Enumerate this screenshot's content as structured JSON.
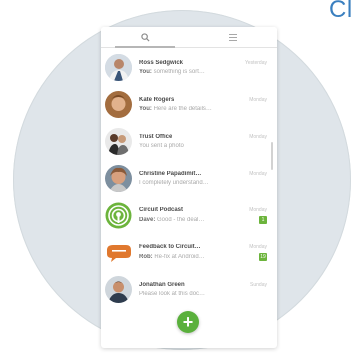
{
  "heading_fragment": "Cl",
  "tabs": [
    {
      "icon": "search-icon",
      "active": true
    },
    {
      "icon": "menu-icon",
      "active": false
    }
  ],
  "conversations": [
    {
      "name": "Ross Sedgwick",
      "time": "Yesterday",
      "sender": "You:",
      "preview": "something is sort…",
      "avatar": "person-photo",
      "unread": ""
    },
    {
      "name": "Kate Rogers",
      "time": "Monday",
      "sender": "You:",
      "preview": "Here are the details…",
      "avatar": "person-photo",
      "unread": ""
    },
    {
      "name": "Trust Office",
      "time": "Monday",
      "sender": "",
      "preview": "You sent a photo",
      "avatar": "person-photo",
      "unread": ""
    },
    {
      "name": "Christine Papadimit…",
      "time": "Monday",
      "sender": "",
      "preview": "I completely understand…",
      "avatar": "person-photo",
      "unread": ""
    },
    {
      "name": "Circuit Podcast",
      "time": "Monday",
      "sender": "Dave:",
      "preview": "Good - the deal…",
      "avatar": "podcast-icon",
      "unread": "1"
    },
    {
      "name": "Feedback to Circuit…",
      "time": "Monday",
      "sender": "Rob:",
      "preview": "Re-fix at Android…",
      "avatar": "chat-bubble-icon",
      "unread": "19"
    },
    {
      "name": "Jonathan Green",
      "time": "Sunday",
      "sender": "",
      "preview": "Please look at this doc…",
      "avatar": "person-photo",
      "unread": ""
    }
  ],
  "fab": {
    "label": "+"
  },
  "colors": {
    "accent": "#5ab03c",
    "badge_background": "#dfe5ea",
    "heading": "#3a7fbf"
  }
}
